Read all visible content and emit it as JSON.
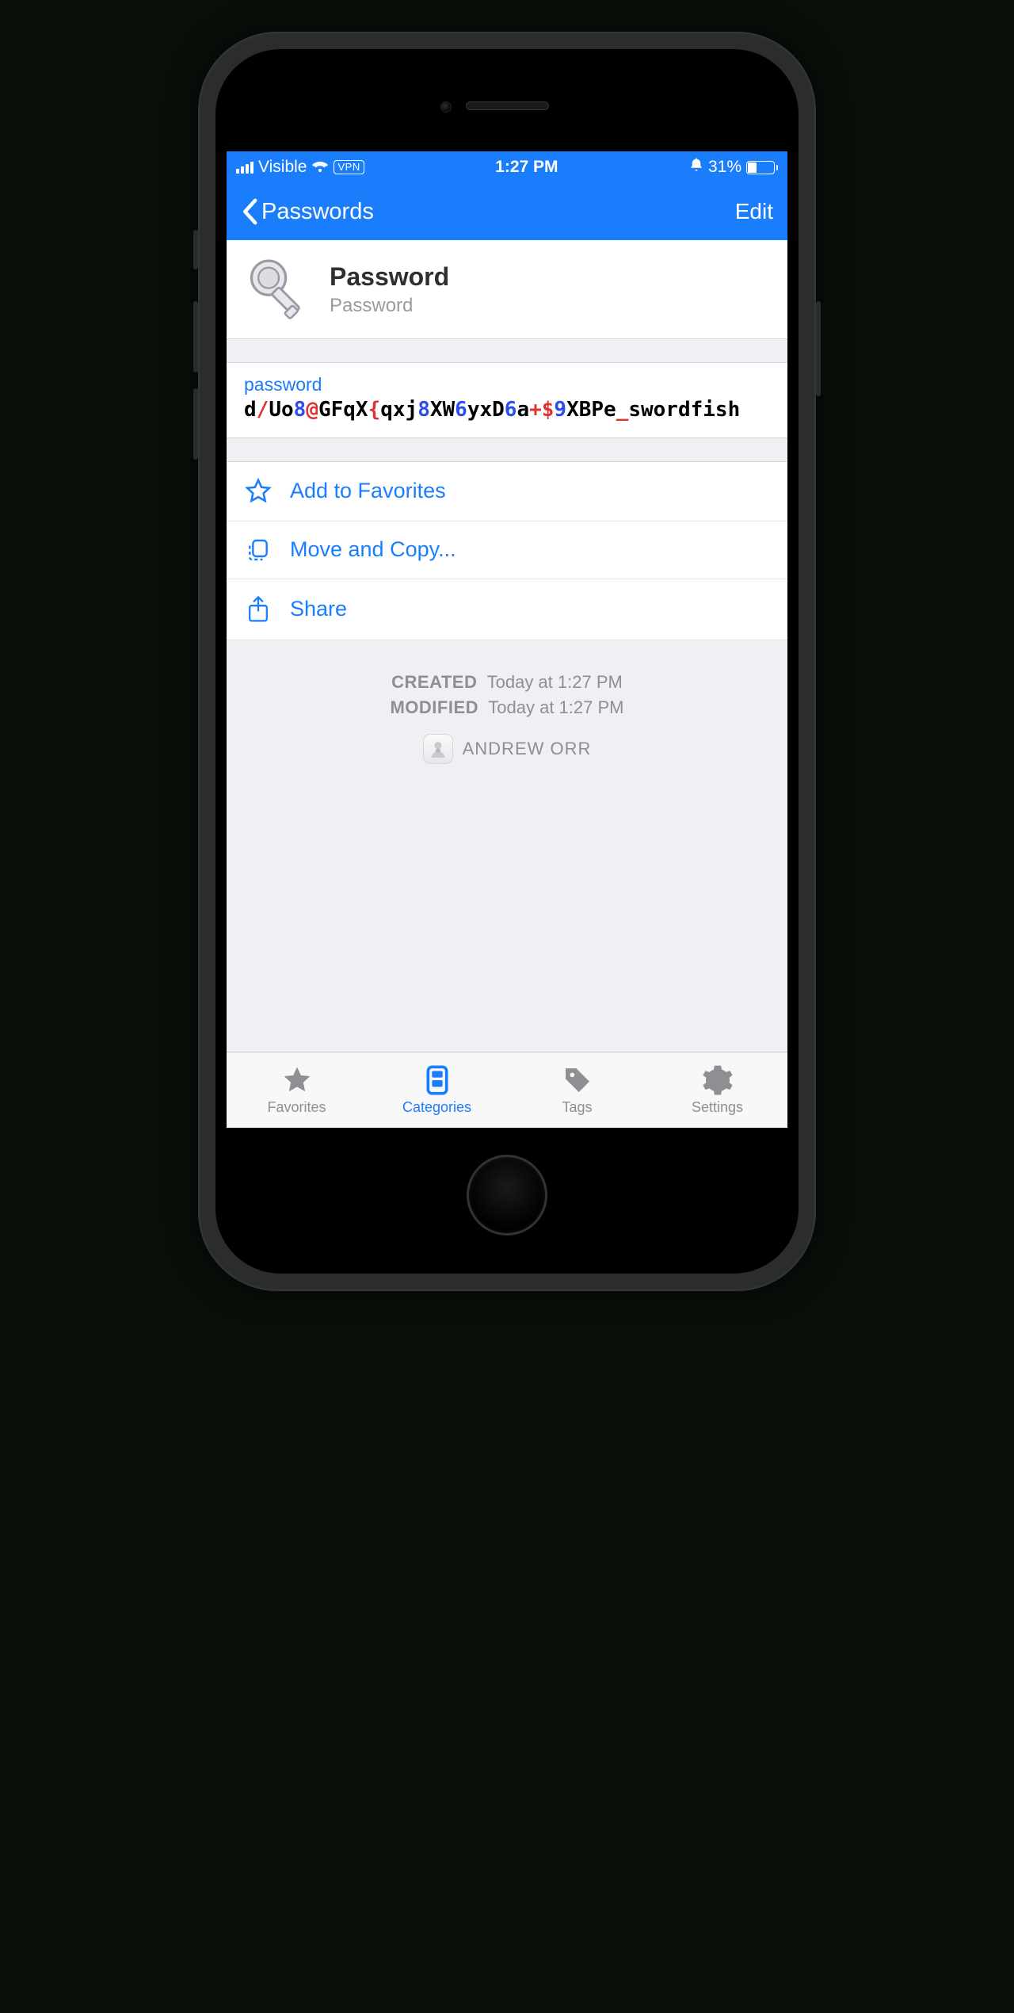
{
  "status": {
    "carrier": "Visible",
    "vpn": "VPN",
    "time": "1:27 PM",
    "battery_pct": "31%"
  },
  "nav": {
    "back_label": "Passwords",
    "edit_label": "Edit"
  },
  "item": {
    "title": "Password",
    "subtitle": "Password"
  },
  "field": {
    "label": "password",
    "password_segments": [
      {
        "t": "d",
        "c": "l"
      },
      {
        "t": "/",
        "c": "s"
      },
      {
        "t": "Uo",
        "c": "l"
      },
      {
        "t": "8",
        "c": "d"
      },
      {
        "t": "@",
        "c": "s"
      },
      {
        "t": "GFqX",
        "c": "l"
      },
      {
        "t": "{",
        "c": "s"
      },
      {
        "t": "qxj",
        "c": "l"
      },
      {
        "t": "8",
        "c": "d"
      },
      {
        "t": "XW",
        "c": "l"
      },
      {
        "t": "6",
        "c": "d"
      },
      {
        "t": "yxD",
        "c": "l"
      },
      {
        "t": "6",
        "c": "d"
      },
      {
        "t": "a",
        "c": "l"
      },
      {
        "t": "+$",
        "c": "s"
      },
      {
        "t": "9",
        "c": "d"
      },
      {
        "t": "XBPe",
        "c": "l"
      },
      {
        "t": "_",
        "c": "s"
      },
      {
        "t": "swordfish",
        "c": "l"
      }
    ]
  },
  "actions": {
    "favorite": "Add to Favorites",
    "movecopy": "Move and Copy...",
    "share": "Share"
  },
  "meta": {
    "created_label": "CREATED",
    "created_value": "Today at 1:27 PM",
    "modified_label": "MODIFIED",
    "modified_value": "Today at 1:27 PM",
    "author": "ANDREW ORR"
  },
  "tabs": {
    "favorites": "Favorites",
    "categories": "Categories",
    "tags": "Tags",
    "settings": "Settings"
  }
}
